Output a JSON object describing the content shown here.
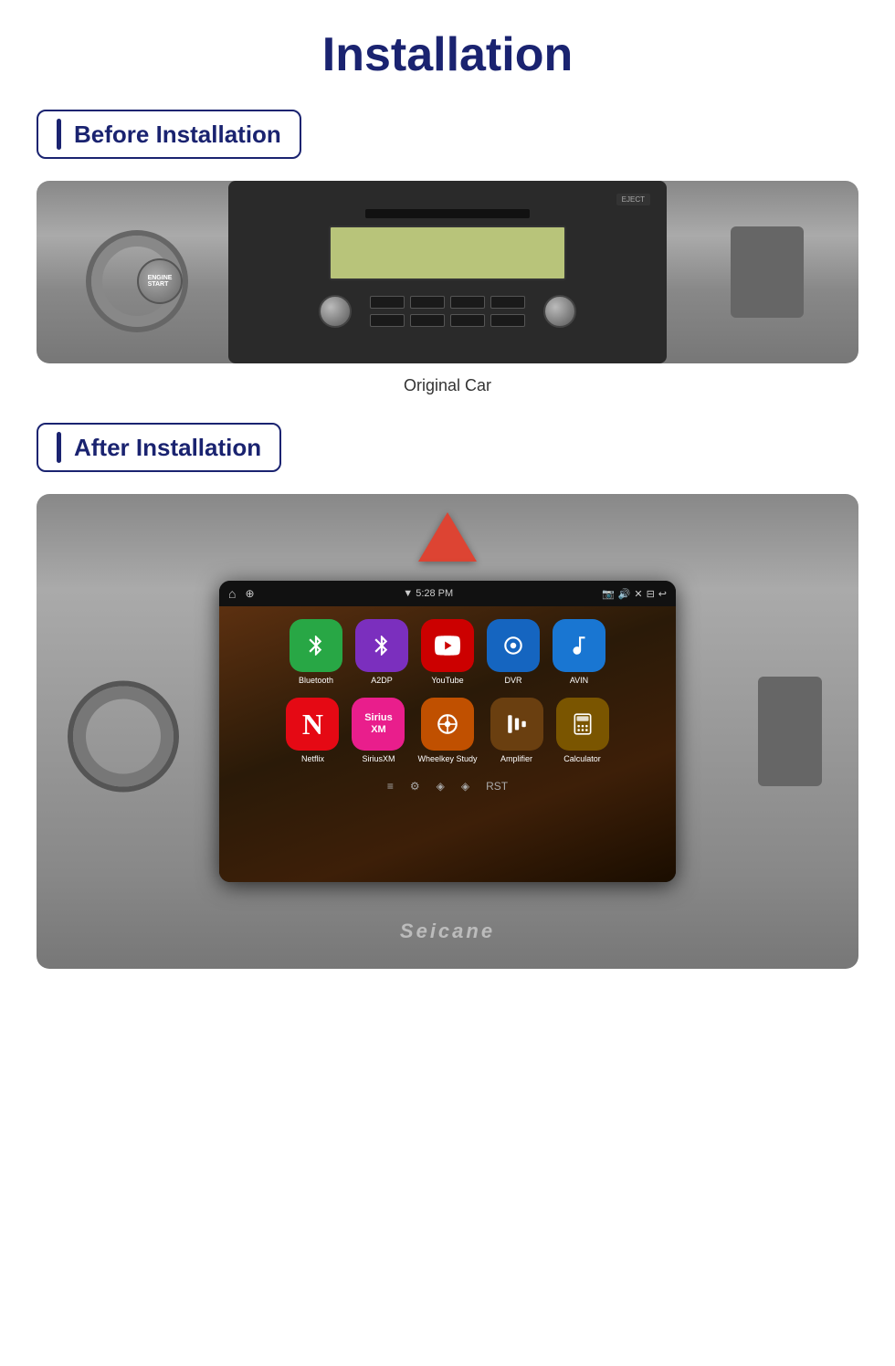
{
  "page": {
    "title": "Installation",
    "before_label": "Before Installation",
    "after_label": "After Installation",
    "caption": "Original Car",
    "seicane": "Seicane",
    "statusbar": {
      "time": "▼ 5:28 PM",
      "icons": [
        "📷",
        "🔊",
        "✕",
        "⊟",
        "↩"
      ]
    },
    "apps_row1": [
      {
        "name": "Bluetooth",
        "icon": "B",
        "bg": "bluetooth"
      },
      {
        "name": "A2DP",
        "icon": "A",
        "bg": "a2dp"
      },
      {
        "name": "YouTube",
        "icon": "▶",
        "bg": "youtube"
      },
      {
        "name": "DVR",
        "icon": "⊙",
        "bg": "dvr"
      },
      {
        "name": "AVIN",
        "icon": "↑",
        "bg": "avin"
      }
    ],
    "apps_row2": [
      {
        "name": "Netflix",
        "icon": "N",
        "bg": "netflix"
      },
      {
        "name": "SiriusXM",
        "icon": "S",
        "bg": "siriusxm"
      },
      {
        "name": "Wheelkey Study",
        "icon": "⊕",
        "bg": "wheelkey"
      },
      {
        "name": "Amplifier",
        "icon": "▦",
        "bg": "amplifier"
      },
      {
        "name": "Calculator",
        "icon": "▦",
        "bg": "calculator"
      }
    ]
  }
}
